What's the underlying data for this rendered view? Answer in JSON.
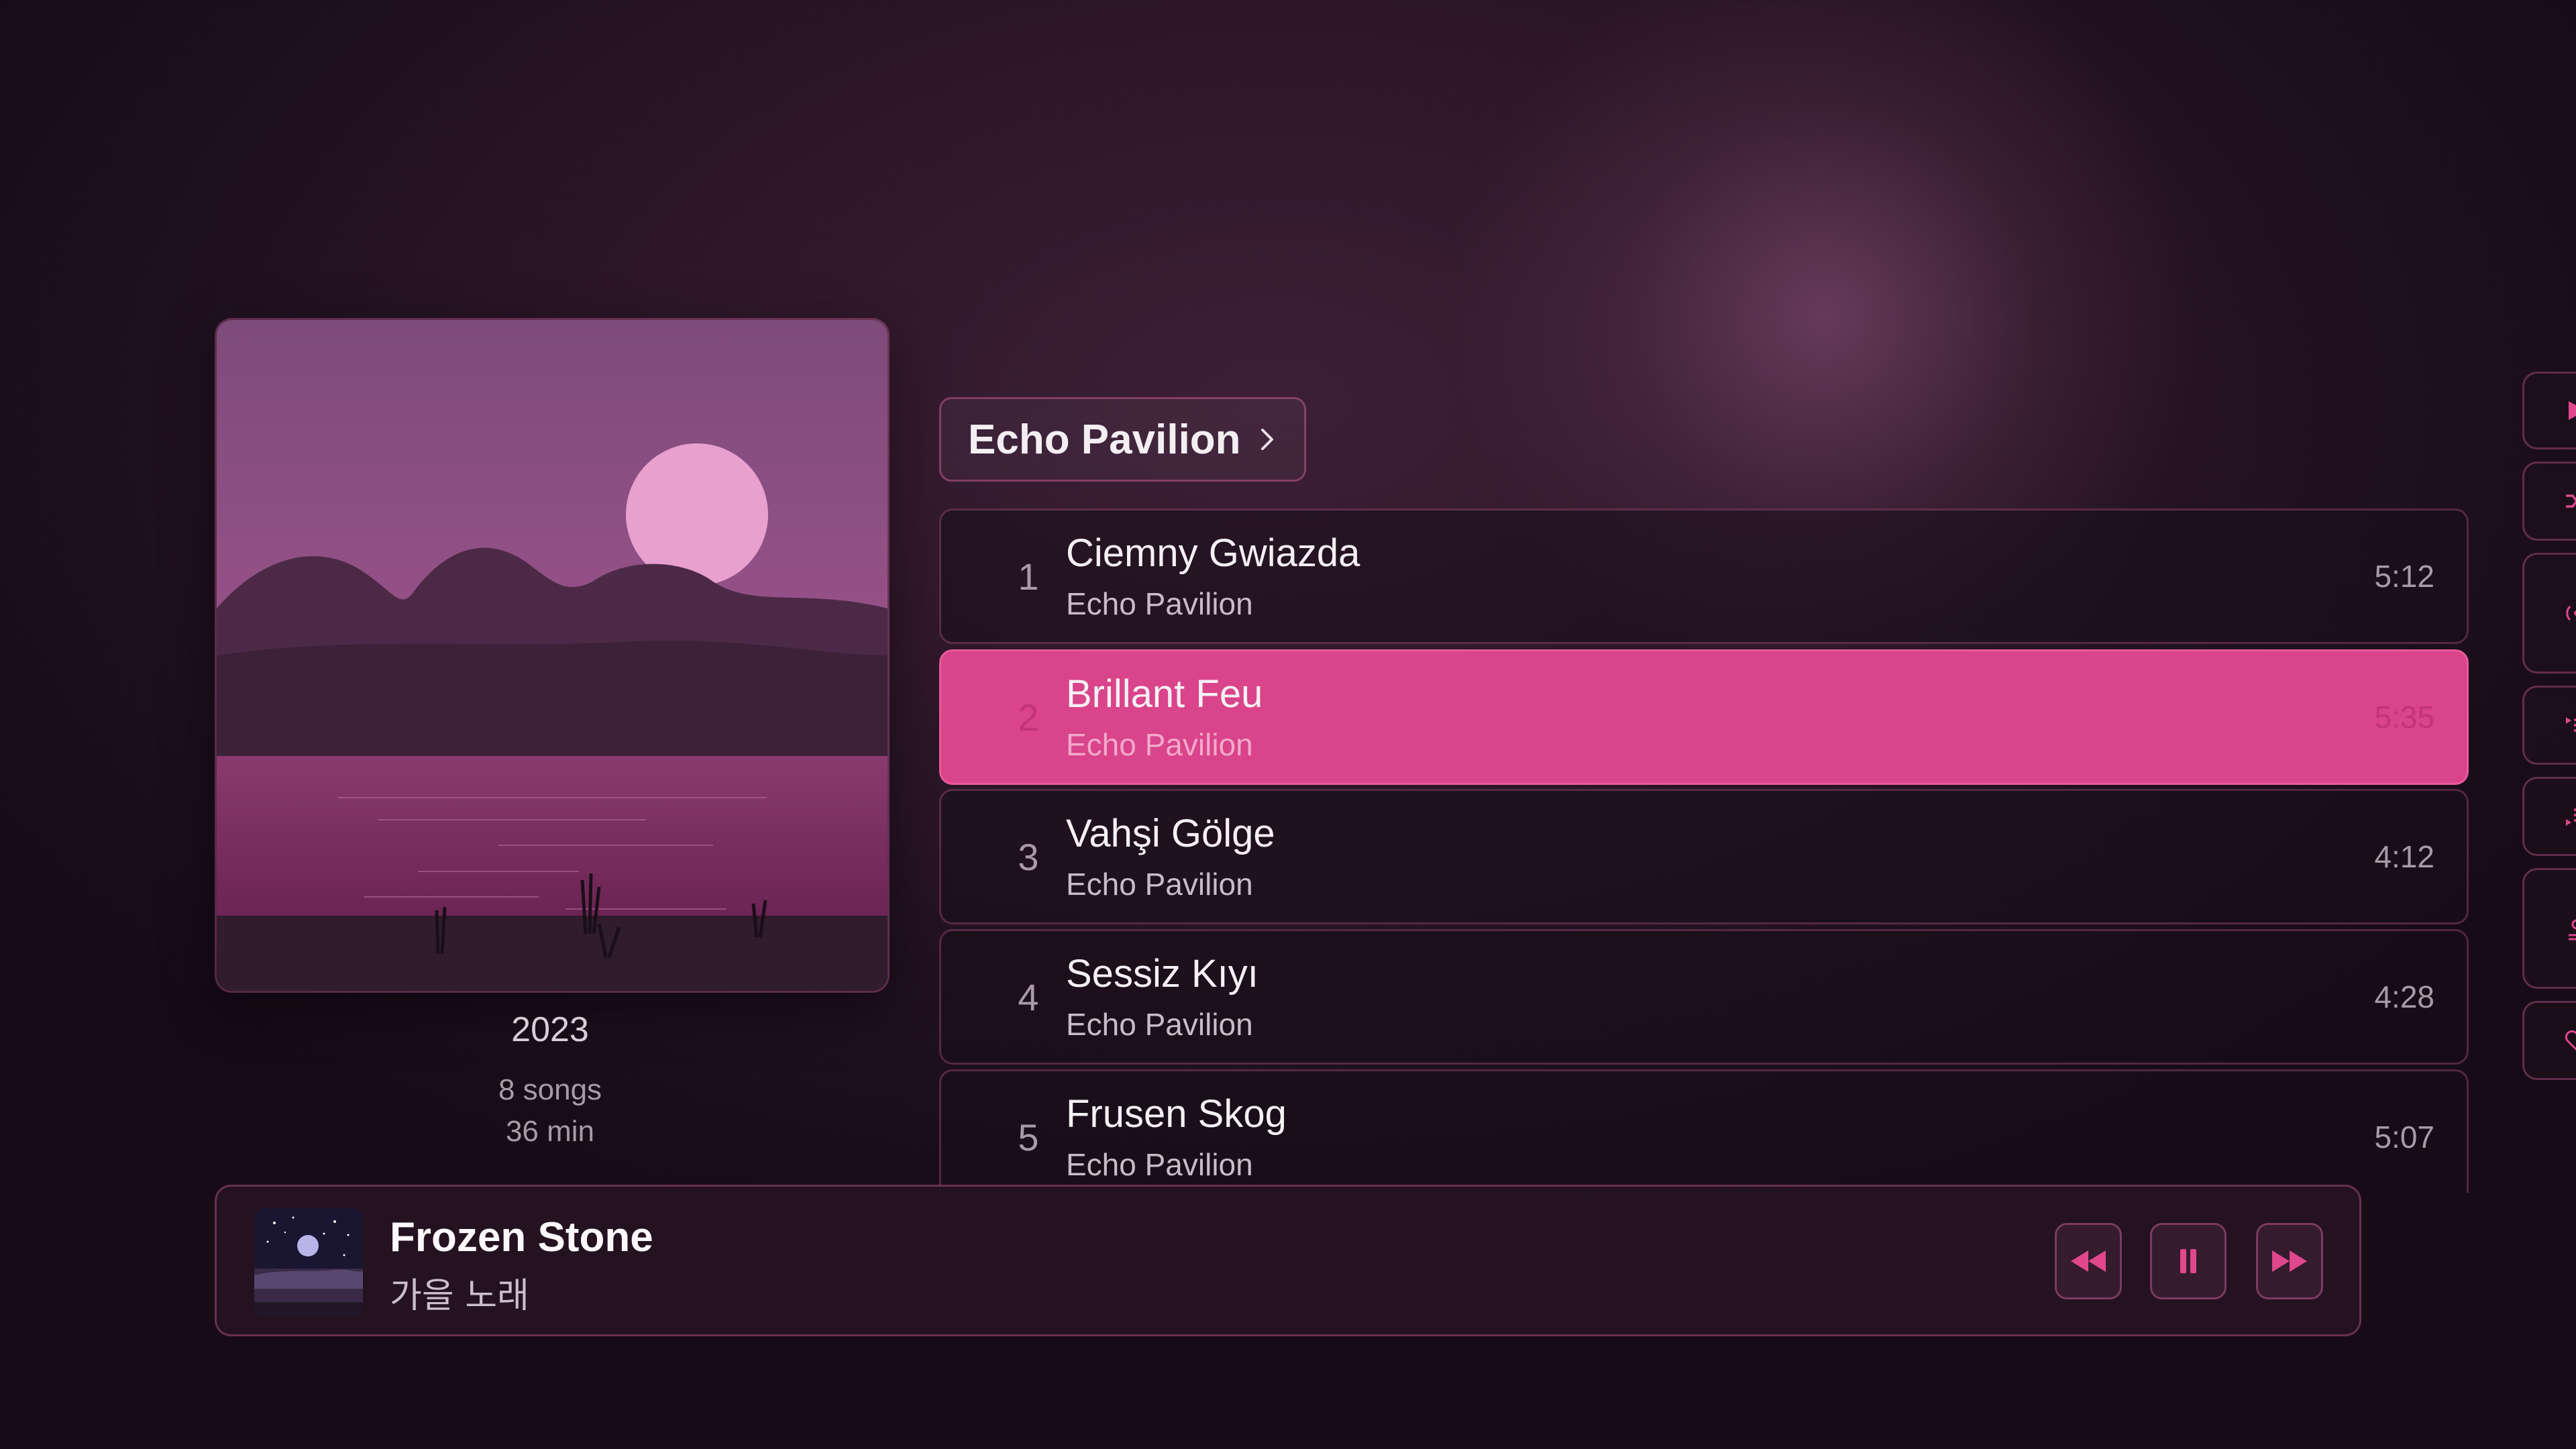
{
  "colors": {
    "accent": "#e0478c",
    "accent_dim": "#c13577",
    "bg_dark": "#1d0f1c"
  },
  "album": {
    "artwork_icon": "album-art-sunset-lake",
    "year": "2023",
    "songs": "8 songs",
    "duration": "36 min"
  },
  "artist_link": {
    "label": "Echo Pavilion",
    "icon": "chevron-right-icon"
  },
  "tracks": [
    {
      "number": "1",
      "title": "Ciemny Gwiazda",
      "artist": "Echo Pavilion",
      "duration": "5:12",
      "active": false
    },
    {
      "number": "2",
      "title": "Brillant Feu",
      "artist": "Echo Pavilion",
      "duration": "5:35",
      "active": true
    },
    {
      "number": "3",
      "title": "Vahşi Gölge",
      "artist": "Echo Pavilion",
      "duration": "4:12",
      "active": false
    },
    {
      "number": "4",
      "title": "Sessiz Kıyı",
      "artist": "Echo Pavilion",
      "duration": "4:28",
      "active": false
    },
    {
      "number": "5",
      "title": "Frusen Skog",
      "artist": "Echo Pavilion",
      "duration": "5:07",
      "active": false
    }
  ],
  "side_actions": [
    "play-icon",
    "shuffle-icon",
    "radio-icon",
    "play-next-icon",
    "play-later-icon",
    "add-to-library-icon",
    "heart-icon"
  ],
  "now_playing": {
    "title": "Frozen Stone",
    "artist": "가을 노래",
    "artwork_icon": "album-art-night-moon",
    "controls": [
      "rewind-icon",
      "pause-icon",
      "fast-forward-icon"
    ]
  }
}
